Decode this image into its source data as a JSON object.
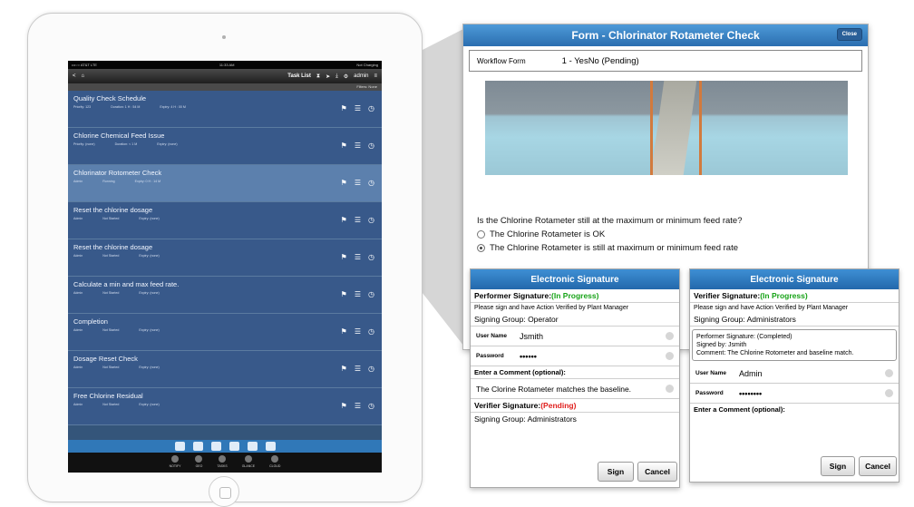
{
  "device": {
    "statusbar": {
      "carrier": "•••○○ AT&T LTE",
      "time": "11:33 AM",
      "battery": "Not Charging"
    },
    "navbar": {
      "back": "<",
      "title": "Task List",
      "user": "admin"
    },
    "filter_text": "Filters: None",
    "tasks": [
      {
        "name": "Quality Check Schedule",
        "c1": "Priority: 123",
        "c2": "Duration: 1 H : 54 M",
        "c3": "Expiry: 4 H : 00 M"
      },
      {
        "name": "Chlorine Chemical Feed Issue",
        "c1": "Priority: (none)",
        "c2": "Duration: < 1 M",
        "c3": "Expiry: (none)"
      },
      {
        "name": "Chlorinator Rotometer Check",
        "c1": "Admin",
        "c2": "Running",
        "c3": "Expiry: 0 H : 14 M"
      },
      {
        "name": "Reset the chlorine dosage",
        "c1": "Admin",
        "c2": "Not Started",
        "c3": "Expiry: (none)"
      },
      {
        "name": "Reset the chlorine dosage",
        "c1": "Admin",
        "c2": "Not Started",
        "c3": "Expiry: (none)"
      },
      {
        "name": "Calculate a min and max feed rate.",
        "c1": "Admin",
        "c2": "Not Started",
        "c3": "Expiry: (none)"
      },
      {
        "name": "Completion",
        "c1": "Admin",
        "c2": "Not Started",
        "c3": "Expiry: (none)"
      },
      {
        "name": "Dosage Reset Check",
        "c1": "Admin",
        "c2": "Not Started",
        "c3": "Expiry: (none)"
      },
      {
        "name": "Free Chlorine Residual",
        "c1": "Admin",
        "c2": "Not Started",
        "c3": "Expiry: (none)"
      }
    ],
    "tabs": [
      "NOTIFY",
      "GEO",
      "TASKS",
      "GLANCE",
      "CLOUD"
    ]
  },
  "form": {
    "title": "Form - Chlorinator Rotameter Check",
    "close": "Close",
    "workflow_label": "Workflow Form",
    "workflow_value": "1 - YesNo (Pending)",
    "question": "Is the Chlorine Rotameter still at the maximum or minimum feed rate?",
    "option1": "The Chlorine Rotameter is OK",
    "option2": "The Chlorine Rotameter is still at maximum or minimum feed rate"
  },
  "sig_left": {
    "title": "Electronic Signature",
    "perf_label": "Performer Signature:",
    "perf_status": "(In Progress)",
    "note": "Please sign and have Action Verified by Plant Manager",
    "group": "Signing Group: Operator",
    "user_label": "User Name",
    "user_value": "Jsmith",
    "pass_label": "Password",
    "pass_value": "••••••",
    "comment_label": "Enter a Comment (optional):",
    "comment_value": "The Clorine Rotameter matches the baseline.",
    "ver_label": "Verifier Signature:",
    "ver_status": "(Pending)",
    "ver_group": "Signing Group: Administrators",
    "sign": "Sign",
    "cancel": "Cancel"
  },
  "sig_right": {
    "title": "Electronic Signature",
    "ver_label": "Verifier Signature:",
    "ver_status": "(In Progress)",
    "note": "Please sign and have Action Verified by Plant Manager",
    "group": "Signing Group: Administrators",
    "info1": "Performer Signature: (Completed)",
    "info2": "Signed by: Jsmith",
    "info3": "Comment: The Chlorine Rotometer and baseline match.",
    "user_label": "User Name",
    "user_value": "Admin",
    "pass_label": "Password",
    "pass_value": "••••••••",
    "comment_label": "Enter a Comment (optional):",
    "sign": "Sign",
    "cancel": "Cancel"
  }
}
